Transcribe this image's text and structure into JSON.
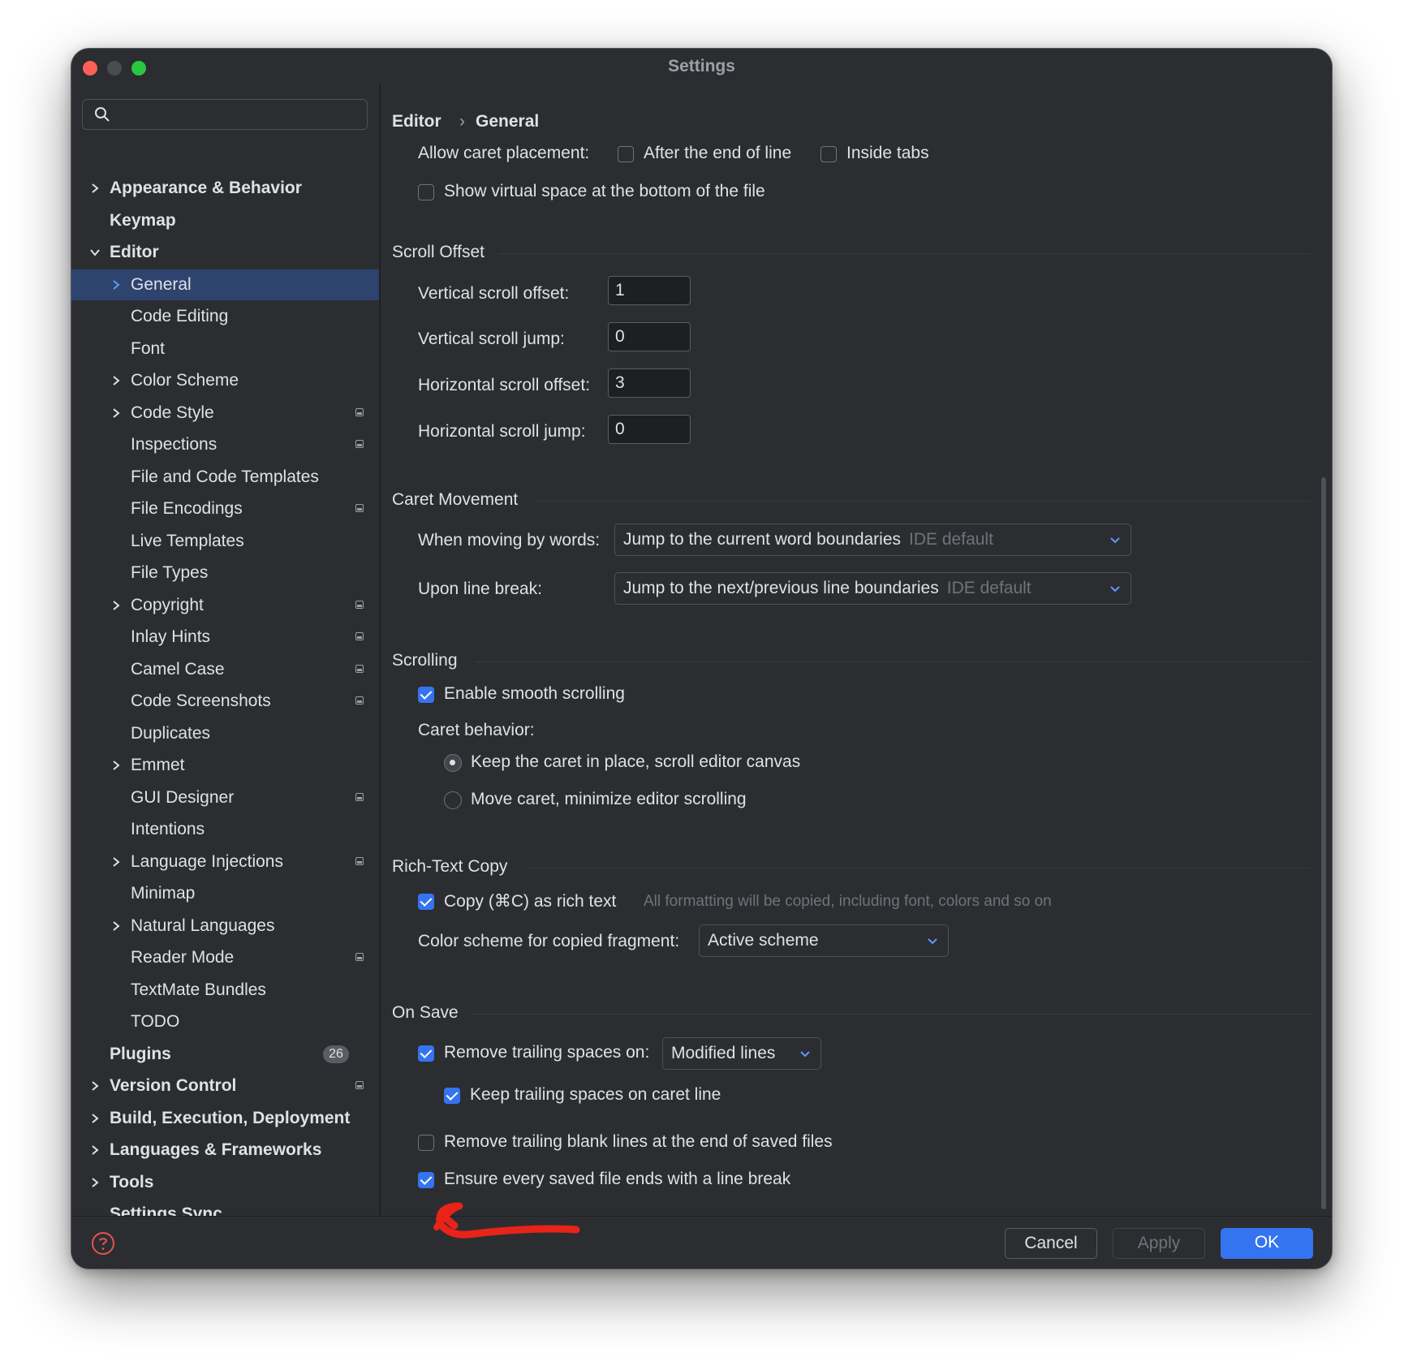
{
  "window": {
    "title": "Settings"
  },
  "sidebar": {
    "search": {
      "placeholder": ""
    },
    "items": [
      {
        "label": "Appearance & Behavior"
      },
      {
        "label": "Keymap"
      },
      {
        "label": "Editor"
      },
      {
        "label": "General"
      },
      {
        "label": "Code Editing"
      },
      {
        "label": "Font"
      },
      {
        "label": "Color Scheme"
      },
      {
        "label": "Code Style"
      },
      {
        "label": "Inspections"
      },
      {
        "label": "File and Code Templates"
      },
      {
        "label": "File Encodings"
      },
      {
        "label": "Live Templates"
      },
      {
        "label": "File Types"
      },
      {
        "label": "Copyright"
      },
      {
        "label": "Inlay Hints"
      },
      {
        "label": "Camel Case"
      },
      {
        "label": "Code Screenshots"
      },
      {
        "label": "Duplicates"
      },
      {
        "label": "Emmet"
      },
      {
        "label": "GUI Designer"
      },
      {
        "label": "Intentions"
      },
      {
        "label": "Language Injections"
      },
      {
        "label": "Minimap"
      },
      {
        "label": "Natural Languages"
      },
      {
        "label": "Reader Mode"
      },
      {
        "label": "TextMate Bundles"
      },
      {
        "label": "TODO"
      },
      {
        "label": "Plugins",
        "badge": "26"
      },
      {
        "label": "Version Control"
      },
      {
        "label": "Build, Execution, Deployment"
      },
      {
        "label": "Languages & Frameworks"
      },
      {
        "label": "Tools"
      },
      {
        "label": "Settings Sync"
      }
    ]
  },
  "breadcrumb": {
    "parent": "Editor",
    "separator": "›",
    "current": "General"
  },
  "caret_placement": {
    "label": "Allow caret placement:",
    "after_end_of_line": "After the end of line",
    "inside_tabs": "Inside tabs",
    "virtual_space": "Show virtual space at the bottom of the file"
  },
  "scroll_offset": {
    "title": "Scroll Offset",
    "vertical_offset_label": "Vertical scroll offset:",
    "vertical_offset_value": "1",
    "vertical_jump_label": "Vertical scroll jump:",
    "vertical_jump_value": "0",
    "horizontal_offset_label": "Horizontal scroll offset:",
    "horizontal_offset_value": "3",
    "horizontal_jump_label": "Horizontal scroll jump:",
    "horizontal_jump_value": "0"
  },
  "caret_movement": {
    "title": "Caret Movement",
    "words_label": "When moving by words:",
    "words_value": "Jump to the current word boundaries",
    "words_hint": "IDE default",
    "line_break_label": "Upon line break:",
    "line_break_value": "Jump to the next/previous line boundaries",
    "line_break_hint": "IDE default"
  },
  "scrolling": {
    "title": "Scrolling",
    "smooth_label": "Enable smooth scrolling",
    "smooth_checked": true,
    "caret_behavior_label": "Caret behavior:",
    "option_keep": "Keep the caret in place, scroll editor canvas",
    "option_move": "Move caret, minimize editor scrolling",
    "selected_option": "keep"
  },
  "rich_text_copy": {
    "title": "Rich-Text Copy",
    "copy_label": "Copy (⌘C) as rich text",
    "copy_checked": true,
    "copy_hint": "All formatting will be copied, including font, colors and so on",
    "scheme_label": "Color scheme for copied fragment:",
    "scheme_value": "Active scheme"
  },
  "on_save": {
    "title": "On Save",
    "remove_trailing_label": "Remove trailing spaces on:",
    "remove_trailing_checked": true,
    "remove_trailing_value": "Modified lines",
    "keep_caret_label": "Keep trailing spaces on caret line",
    "keep_caret_checked": true,
    "remove_blank_label": "Remove trailing blank lines at the end of saved files",
    "remove_blank_checked": false,
    "ensure_newline_label": "Ensure every saved file ends with a line break",
    "ensure_newline_checked": true
  },
  "footer": {
    "cancel": "Cancel",
    "apply": "Apply",
    "ok": "OK"
  },
  "colors": {
    "accent": "#3574f0",
    "background": "#2b2d30",
    "selected": "#2e436e",
    "annotation": "#e8231a"
  }
}
